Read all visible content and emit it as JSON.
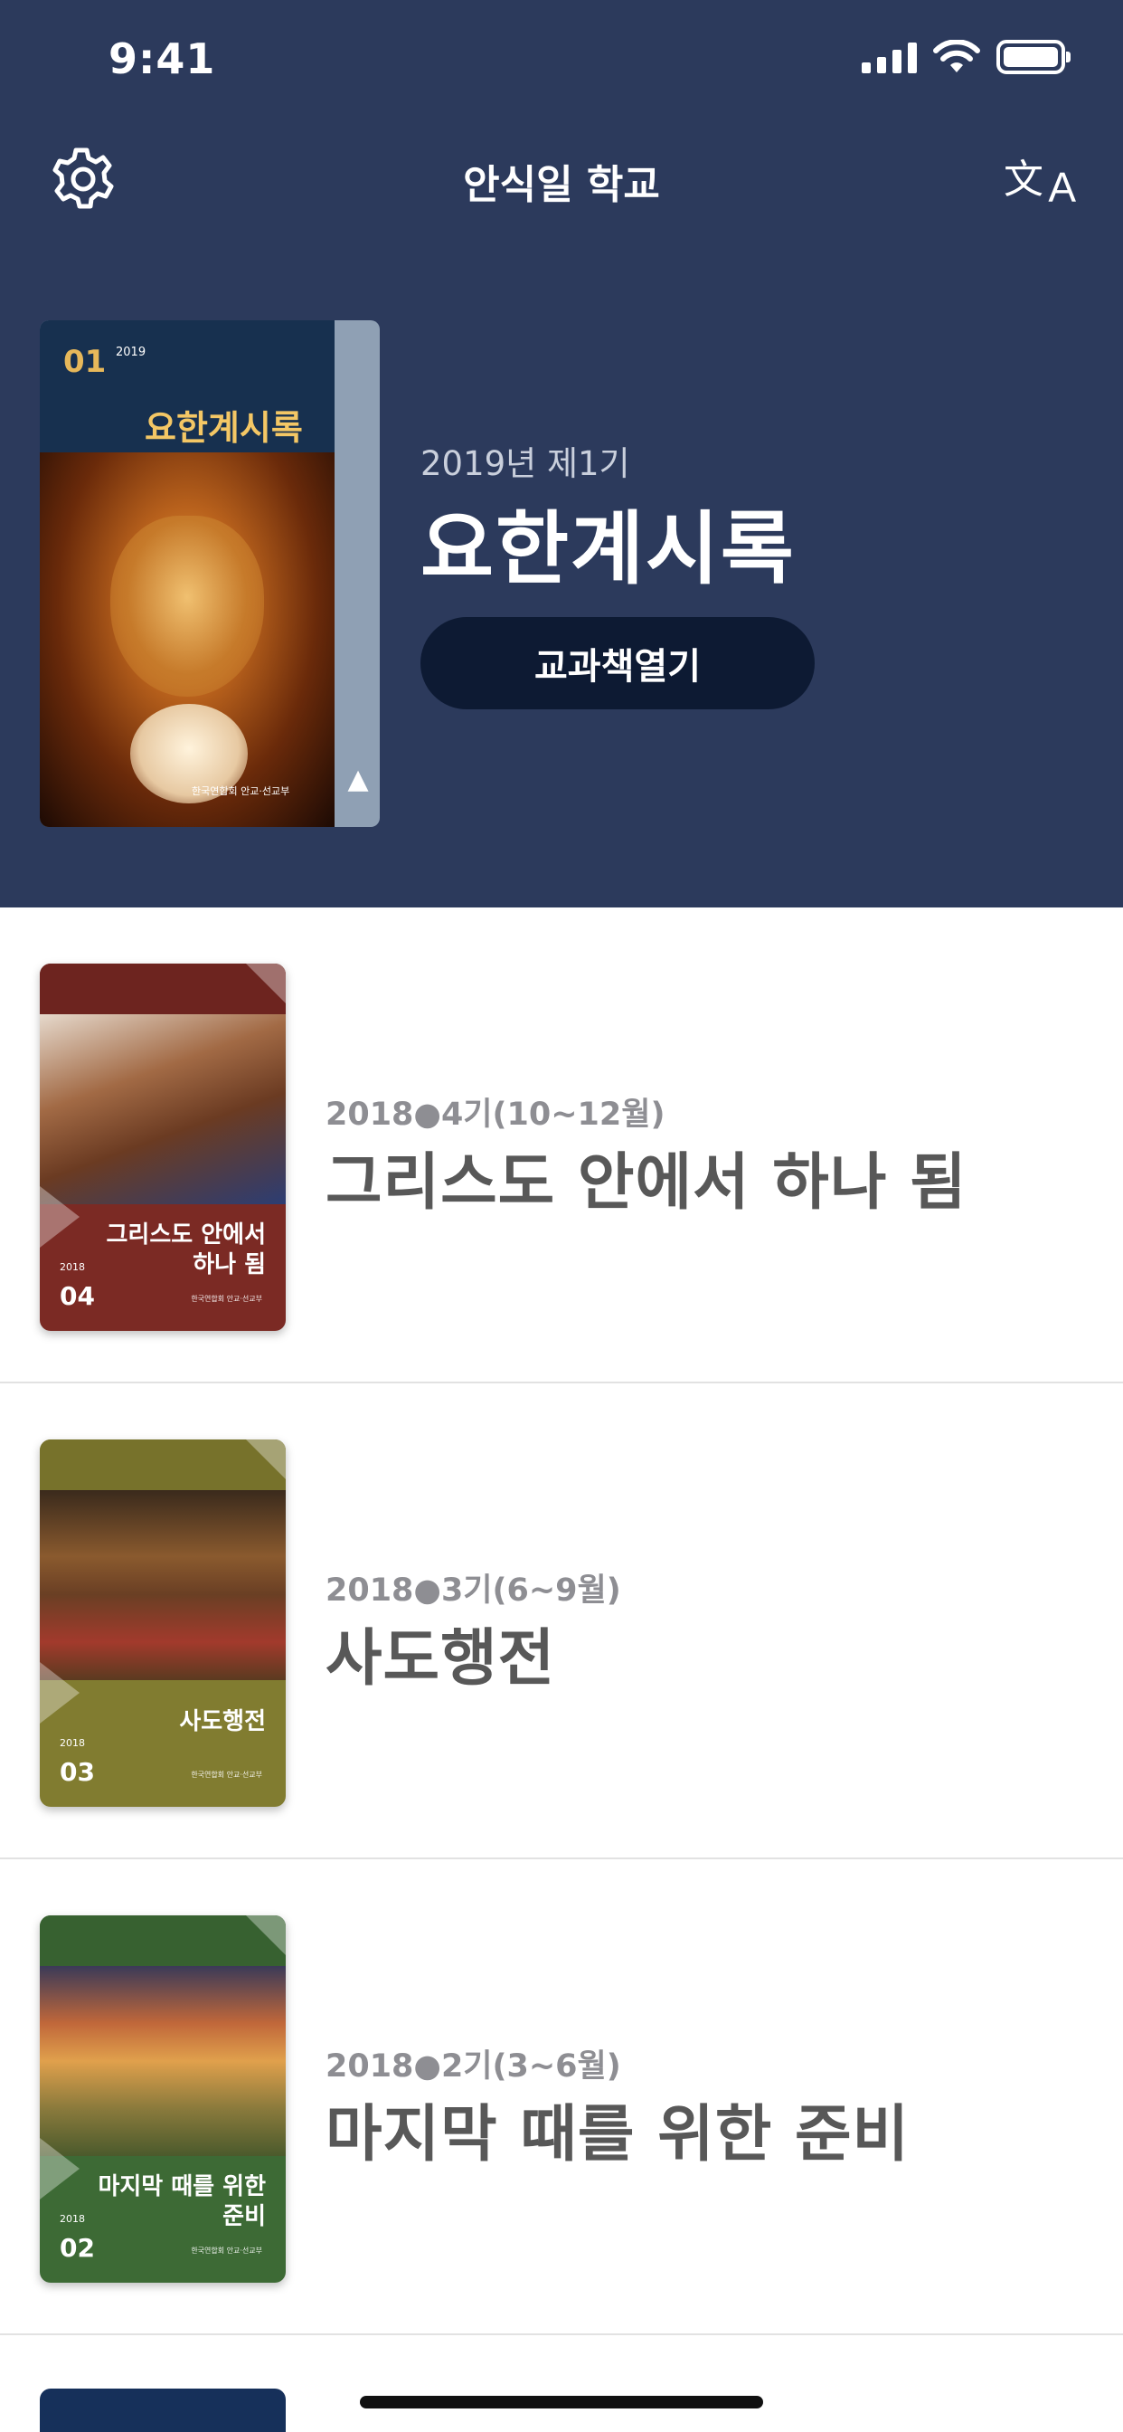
{
  "status_bar": {
    "time": "9:41"
  },
  "navbar": {
    "title": "안식일 학교",
    "settings_icon": "gear-icon",
    "language_icon": "translate-icon",
    "translate_zh": "文",
    "translate_a": "A"
  },
  "featured": {
    "cover": {
      "number": "01",
      "year": "2019",
      "title": "요한계시록",
      "publisher": "한국연합회 안교·선교부"
    },
    "subtitle": "2019년 제1기",
    "title": "요한계시록",
    "open_button": "교과책열기"
  },
  "lessons": [
    {
      "subtitle": "2018●4기(10~12월)",
      "title": "그리스도 안에서 하나 됨",
      "cover": {
        "title": "그리스도 안에서\n하나 됨",
        "year": "2018",
        "number": "04",
        "publisher": "한국연합회 안교·선교부",
        "color": "#7b2a24"
      }
    },
    {
      "subtitle": "2018●3기(6~9월)",
      "title": "사도행전",
      "cover": {
        "title": "사도행전",
        "year": "2018",
        "number": "03",
        "publisher": "한국연합회 안교·선교부",
        "color": "#817c30"
      }
    },
    {
      "subtitle": "2018●2기(3~6월)",
      "title": "마지막 때를 위한 준비",
      "cover": {
        "title": "마지막 때를 위한\n준비",
        "year": "2018",
        "number": "02",
        "publisher": "한국연합회 안교·선교부",
        "color": "#3d6a35"
      }
    }
  ],
  "colors": {
    "header_bg": "#2c3a5c",
    "button_bg": "#0d1a33"
  }
}
